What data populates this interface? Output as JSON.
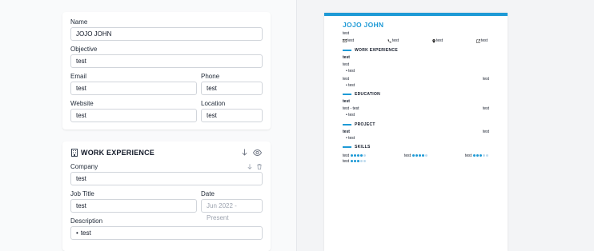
{
  "profile": {
    "name_label": "Name",
    "name_value": "JOJO JOHN",
    "objective_label": "Objective",
    "objective_value": "test",
    "email_label": "Email",
    "email_value": "test",
    "phone_label": "Phone",
    "phone_value": "test",
    "website_label": "Website",
    "website_value": "test",
    "location_label": "Location",
    "location_value": "test"
  },
  "work": {
    "title": "WORK EXPERIENCE",
    "company_label": "Company",
    "company_value": "test",
    "jobtitle_label": "Job Title",
    "jobtitle_value": "test",
    "date_label": "Date",
    "date_placeholder": "Jun 2022 - Present",
    "description_label": "Description",
    "description_bullet": "•",
    "description_value": "test"
  },
  "icons": [
    "building-icon",
    "arrow-down-icon",
    "eye-icon",
    "trash-icon",
    "mail-icon",
    "phone-icon",
    "location-pin-icon",
    "external-link-icon"
  ],
  "colors": {
    "accent": "#1e9ad6",
    "accent_light": "#bfdbee"
  },
  "resume": {
    "name": "JOJO JOHN",
    "objective": "test",
    "contacts": {
      "email": "test",
      "phone": "test",
      "location": "test",
      "website": "test"
    },
    "work": {
      "heading": "WORK EXPERIENCE",
      "company": "test",
      "title": "test",
      "bullet": "test",
      "title2": "test",
      "date2": "test",
      "bullet2": "test"
    },
    "education": {
      "heading": "EDUCATION",
      "school": "test",
      "degree": "test - test",
      "date": "test",
      "bullet": "test"
    },
    "project": {
      "heading": "PROJECT",
      "name": "test",
      "date": "test",
      "bullet": "test"
    },
    "skills": {
      "heading": "SKILLS",
      "items": [
        {
          "name": "test",
          "level": 4
        },
        {
          "name": "test",
          "level": 4
        },
        {
          "name": "test",
          "level": 3
        },
        {
          "name": "test",
          "level": 3
        }
      ]
    }
  }
}
